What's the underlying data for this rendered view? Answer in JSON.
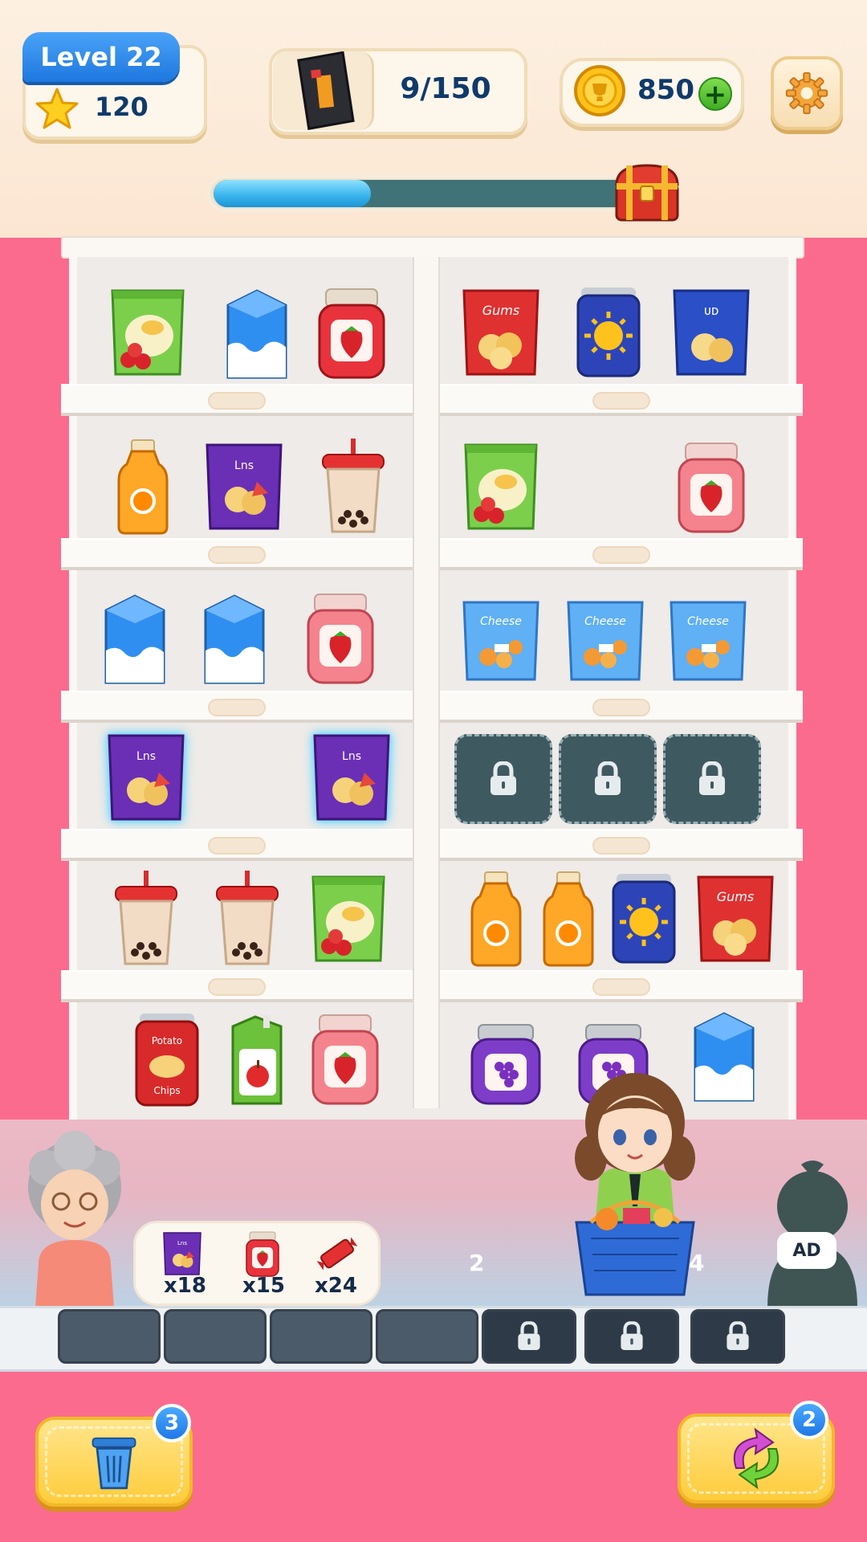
{
  "header": {
    "level_label": "Level 22",
    "stars": "120",
    "goal_progress": "9/150",
    "coins": "850",
    "icons": {
      "star": "star-icon",
      "goal": "snack-bag-icon",
      "coin": "gold-coin-icon",
      "plus": "plus-icon",
      "settings": "gear-icon",
      "reward": "treasure-chest-icon"
    },
    "progress_fraction": 0.36
  },
  "shelf": {
    "rows": [
      {
        "left": [
          "green-chips-bag",
          "milk-carton",
          "strawberry-jam-jar"
        ],
        "right": [
          "red-chips-bag",
          "blue-sun-can",
          "blue-chips-bag"
        ]
      },
      {
        "left": [
          "orange-juice-bottle",
          "purple-chips-bag",
          "bubble-tea-cup"
        ],
        "right": [
          "green-chips-bag",
          "empty",
          "strawberry-jam-jar"
        ]
      },
      {
        "left": [
          "milk-carton",
          "milk-carton",
          "strawberry-jam-jar"
        ],
        "right": [
          "blue-puffs-bag",
          "blue-puffs-bag",
          "blue-puffs-bag"
        ]
      },
      {
        "left": [
          "purple-chips-bag-selected",
          "empty",
          "purple-chips-bag-selected"
        ],
        "right": [
          "locked",
          "locked",
          "locked"
        ]
      },
      {
        "left": [
          "bubble-tea-cup",
          "bubble-tea-cup",
          "green-chips-bag"
        ],
        "right": [
          "orange-juice-bottle",
          "orange-juice-bottle",
          "blue-sun-can",
          "red-chips-bag"
        ]
      },
      {
        "left": [
          "red-chips-can",
          "apple-juice-box",
          "strawberry-jam-jar"
        ],
        "right": [
          "grape-jam-jar",
          "grape-jam-jar",
          "milk-carton"
        ]
      }
    ]
  },
  "order": {
    "items": [
      {
        "icon": "purple-chips-bag-icon",
        "count": "x18"
      },
      {
        "icon": "strawberry-jam-icon",
        "count": "x15"
      },
      {
        "icon": "candy-bar-icon",
        "count": "x24"
      }
    ]
  },
  "queue": {
    "slot_a": "2",
    "slot_b": "4",
    "ad_label": "AD"
  },
  "trays": {
    "open": 4,
    "locked": 3
  },
  "boosters": {
    "trash": {
      "icon": "trash-can-icon",
      "count": "3"
    },
    "shuffle": {
      "icon": "shuffle-arrows-icon",
      "count": "2"
    }
  },
  "colors": {
    "background": "#fb6b8e",
    "accent_blue": "#1e77df",
    "progress": "#37b3ec",
    "booster": "#ffcc3b"
  }
}
